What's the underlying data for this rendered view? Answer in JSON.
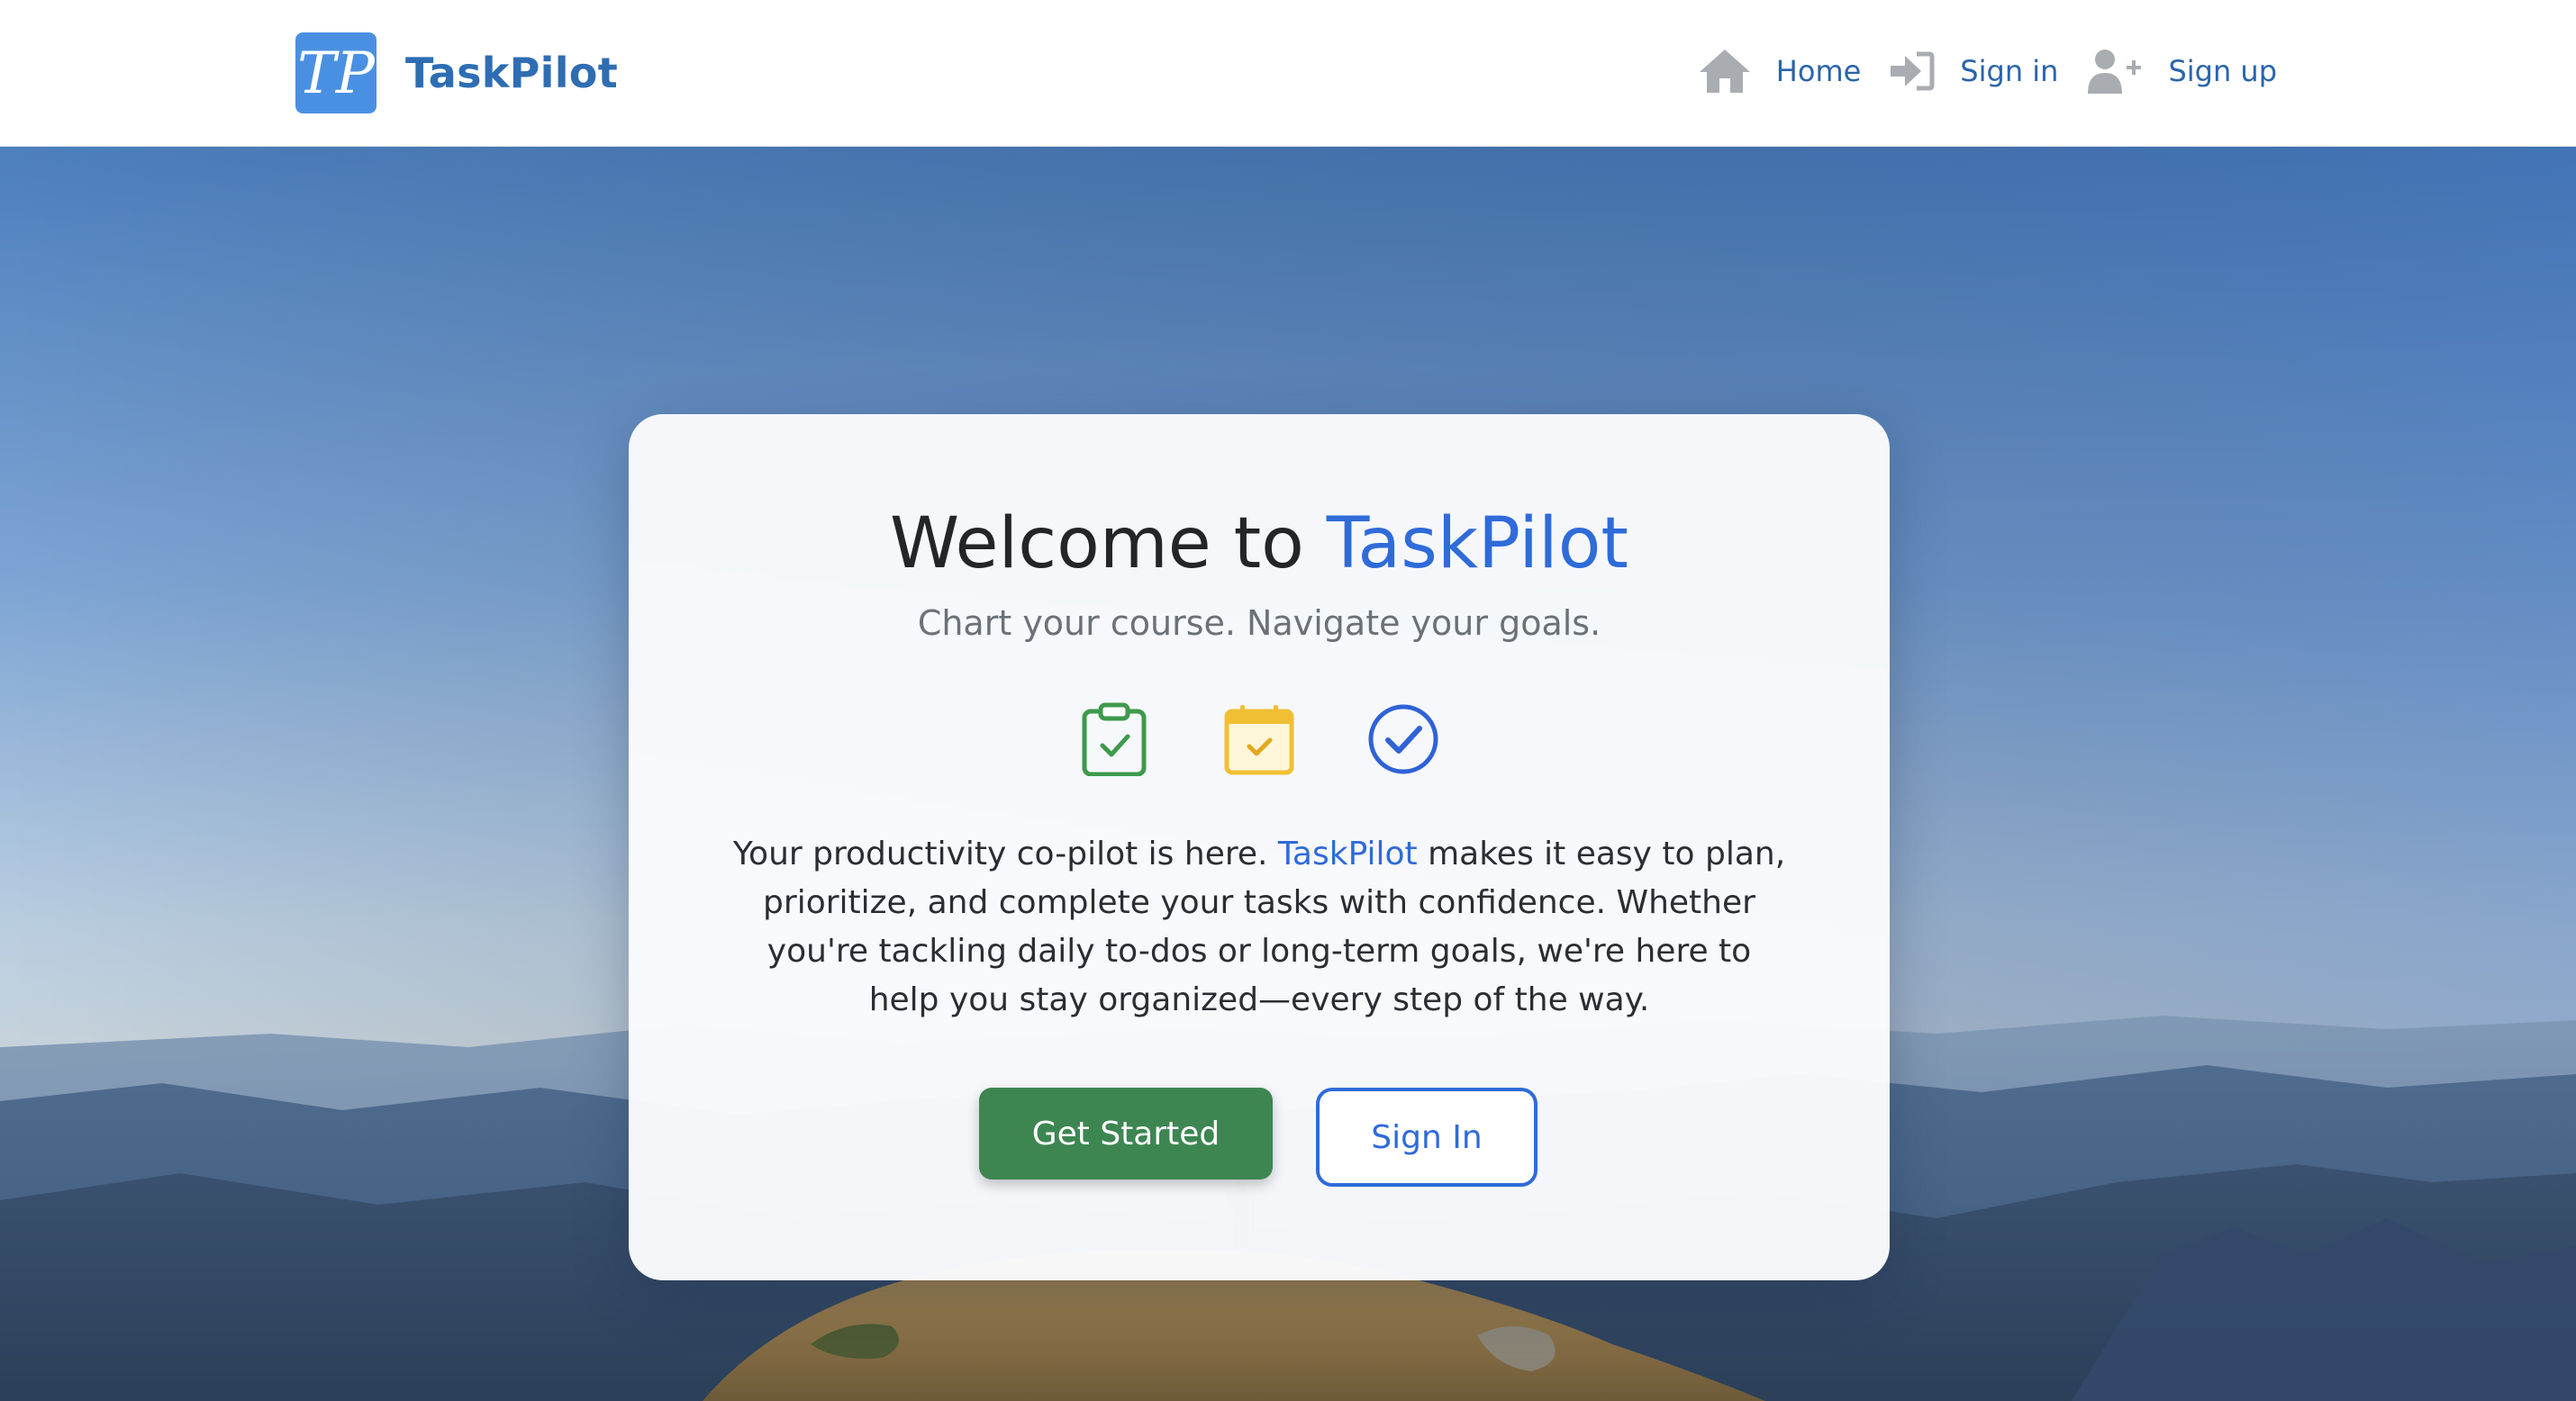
{
  "brand": {
    "name": "TaskPilot",
    "logo_alt": "TP"
  },
  "nav": {
    "items": [
      {
        "label": "Home",
        "icon": "home-icon"
      },
      {
        "label": "Sign in",
        "icon": "sign-in-icon"
      },
      {
        "label": "Sign up",
        "icon": "user-plus-icon"
      }
    ]
  },
  "card": {
    "title_prefix": "Welcome to ",
    "title_brand": "TaskPilot",
    "subtitle": "Chart your course. Navigate your goals.",
    "feature_icons": [
      "clipboard-check-icon",
      "calendar-check-icon",
      "circle-check-icon"
    ],
    "description_before": "Your productivity co-pilot is here. ",
    "description_brand": "TaskPilot",
    "description_after": " makes it easy to plan, prioritize, and complete your tasks with confidence. Whether you're tackling daily to-dos or long-term goals, we're here to help you stay organized—every step of the way.",
    "primary_button": "Get Started",
    "secondary_button": "Sign In"
  },
  "colors": {
    "brand_blue": "#2f6bd9",
    "nav_blue": "#2a64ab",
    "primary_green": "#3d8652",
    "icon_green": "#3e9a4c",
    "icon_yellow": "#f0bf33",
    "icon_blue": "#2f62d6"
  }
}
